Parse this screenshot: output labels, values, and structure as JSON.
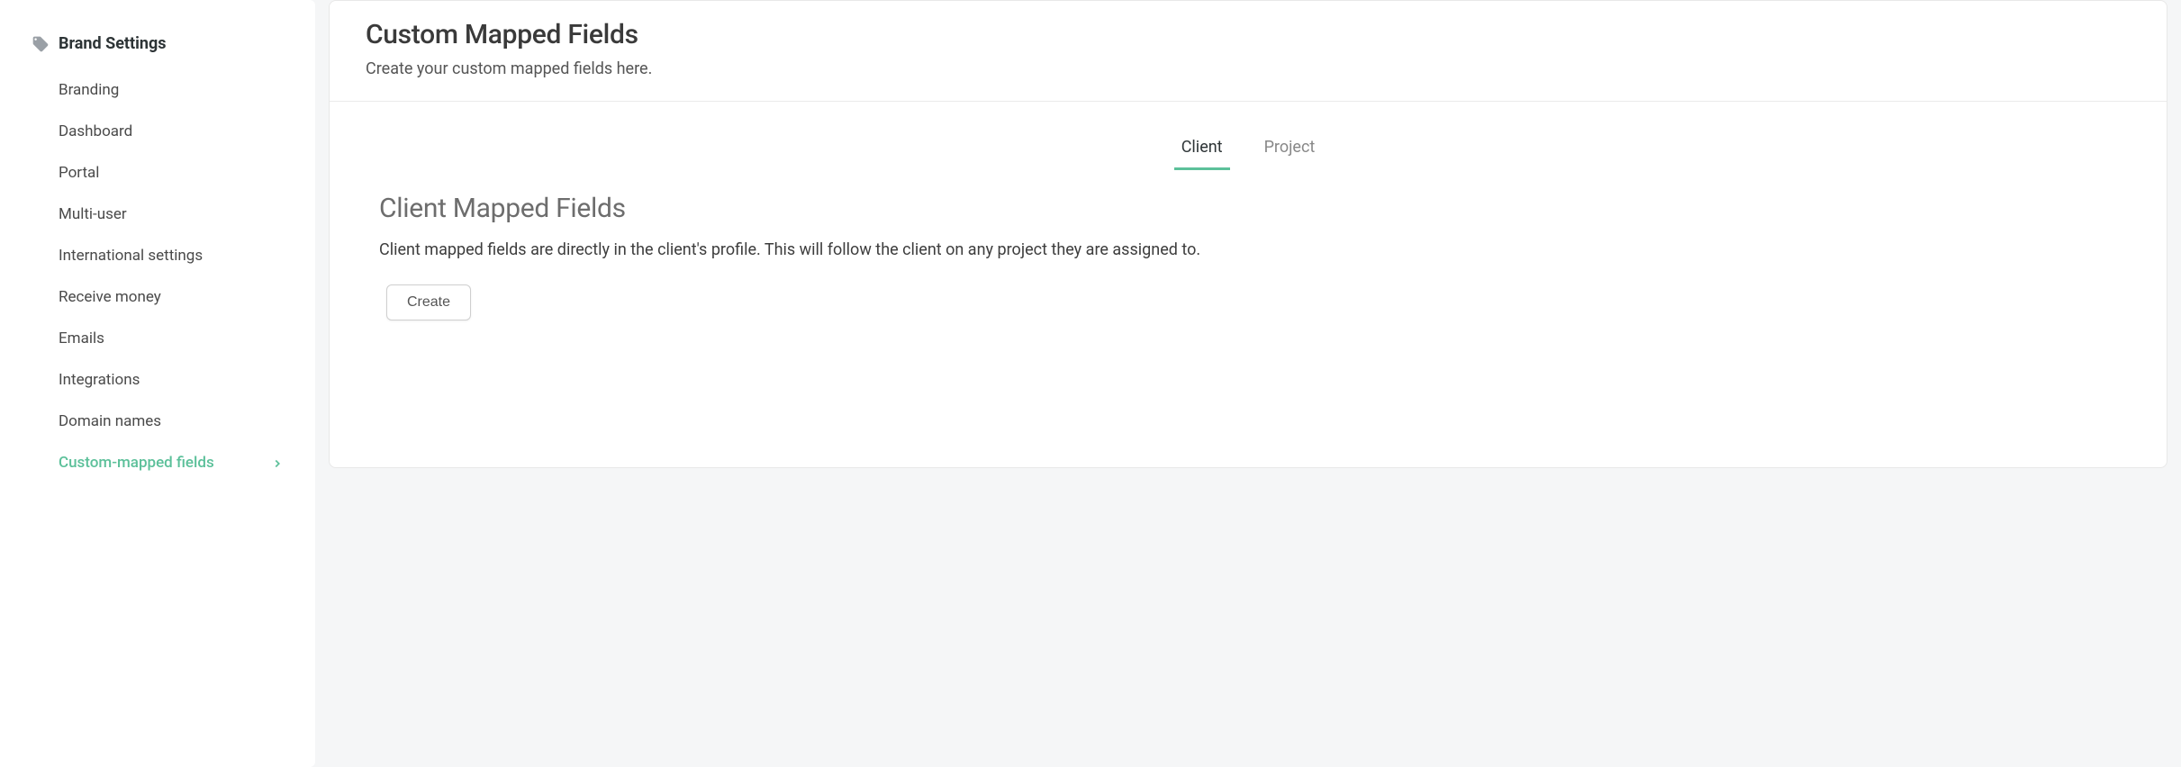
{
  "sidebar": {
    "header": "Brand Settings",
    "items": [
      {
        "label": "Branding",
        "active": false
      },
      {
        "label": "Dashboard",
        "active": false
      },
      {
        "label": "Portal",
        "active": false
      },
      {
        "label": "Multi-user",
        "active": false
      },
      {
        "label": "International settings",
        "active": false
      },
      {
        "label": "Receive money",
        "active": false
      },
      {
        "label": "Emails",
        "active": false
      },
      {
        "label": "Integrations",
        "active": false
      },
      {
        "label": "Domain names",
        "active": false
      },
      {
        "label": "Custom-mapped fields",
        "active": true
      }
    ]
  },
  "main": {
    "title": "Custom Mapped Fields",
    "subtitle": "Create your custom mapped fields here.",
    "tabs": [
      {
        "label": "Client",
        "active": true
      },
      {
        "label": "Project",
        "active": false
      }
    ],
    "section": {
      "title": "Client Mapped Fields",
      "description": "Client mapped fields are directly in the client's profile. This will follow the client on any project they are assigned to.",
      "create_label": "Create"
    }
  },
  "colors": {
    "accent": "#5cc09a"
  }
}
